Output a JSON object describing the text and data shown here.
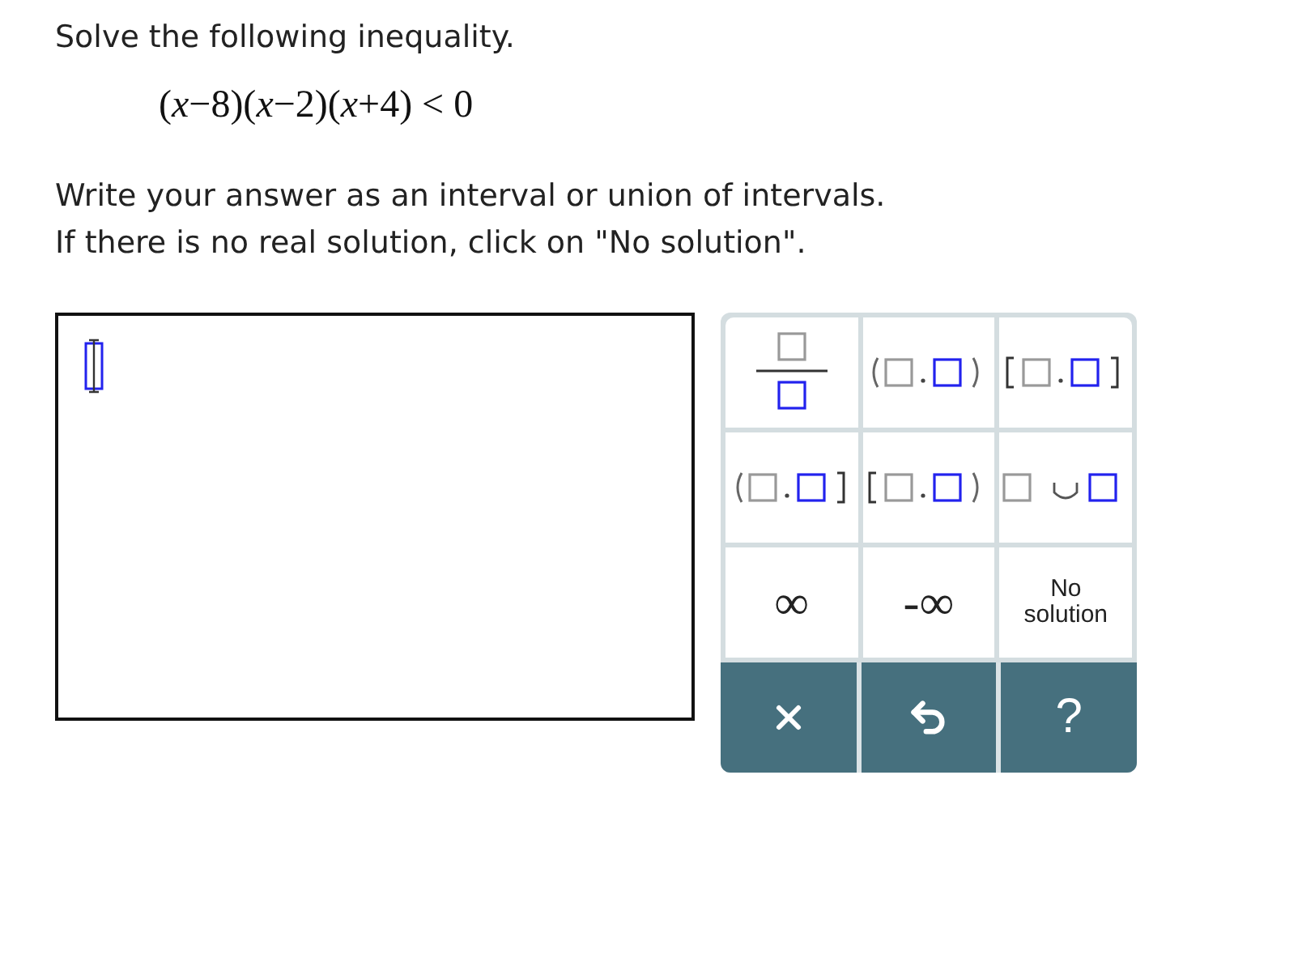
{
  "prompt": "Solve the following inequality.",
  "equation": "(*x*−8)(*x*−2)(*x*+4) < 0",
  "instructions": [
    "Write your answer as an interval or union of intervals.",
    "If there is no real solution, click on \"No solution\"."
  ],
  "answer": {
    "kind": "empty-template"
  },
  "keypad": [
    {
      "kind": "fraction"
    },
    {
      "kind": "open-open"
    },
    {
      "kind": "closed-closed"
    },
    {
      "kind": "open-closed"
    },
    {
      "kind": "closed-open"
    },
    {
      "kind": "union"
    },
    {
      "kind": "text",
      "label": "∞"
    },
    {
      "kind": "text",
      "label": "-∞"
    },
    {
      "kind": "small-text",
      "label": "No solution"
    }
  ],
  "actions": [
    {
      "kind": "clear"
    },
    {
      "kind": "undo"
    },
    {
      "kind": "help",
      "label": "?"
    }
  ]
}
